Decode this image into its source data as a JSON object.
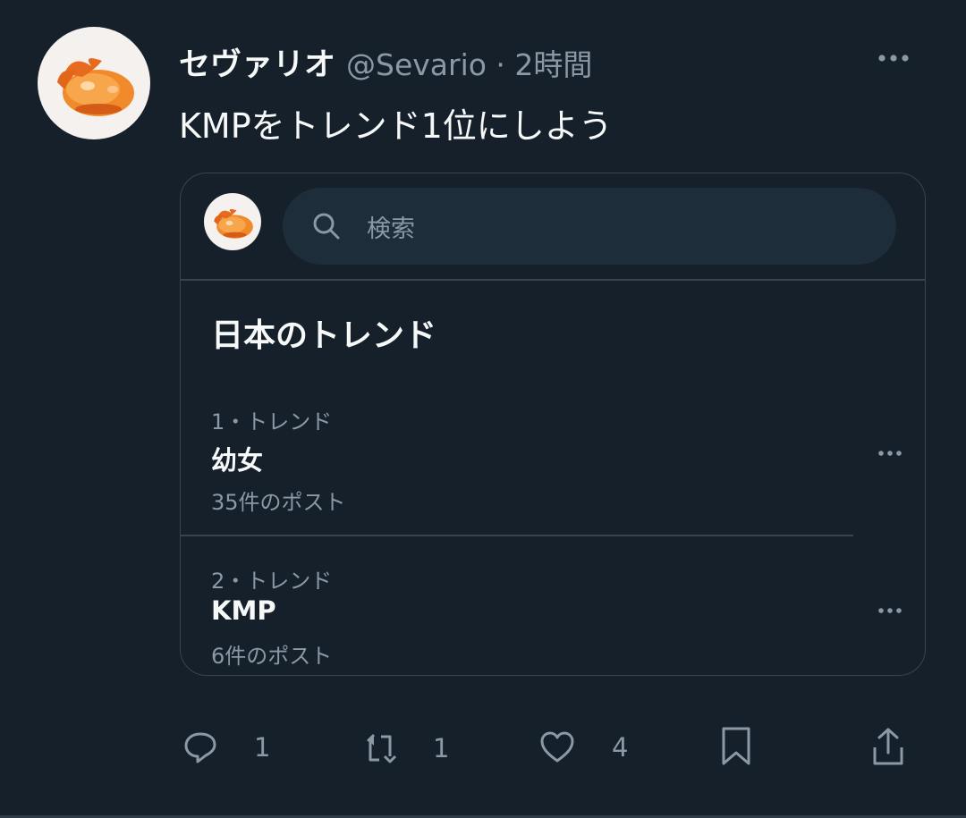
{
  "tweet": {
    "author_name": "セヴァリオ",
    "handle_meta": "@Sevario · 2時間",
    "text": "KMPをトレンド1位にしよう"
  },
  "card": {
    "search_placeholder": "検索",
    "section_title": "日本のトレンド",
    "trends": [
      {
        "meta": "1・トレンド",
        "name": "幼女",
        "count": "35件のポスト"
      },
      {
        "meta": "2・トレンド",
        "name": "KMP",
        "count": "6件のポスト"
      }
    ]
  },
  "actions": {
    "reply_count": "1",
    "retweet_count": "1",
    "like_count": "4"
  },
  "colors": {
    "background": "#15202b",
    "secondary_text": "#8b98a5",
    "border": "#38444d",
    "avatar_orange": "#f28a2c"
  },
  "icons": [
    "more-icon",
    "search-icon",
    "reply-icon",
    "retweet-icon",
    "like-icon",
    "bookmark-icon",
    "share-icon"
  ]
}
